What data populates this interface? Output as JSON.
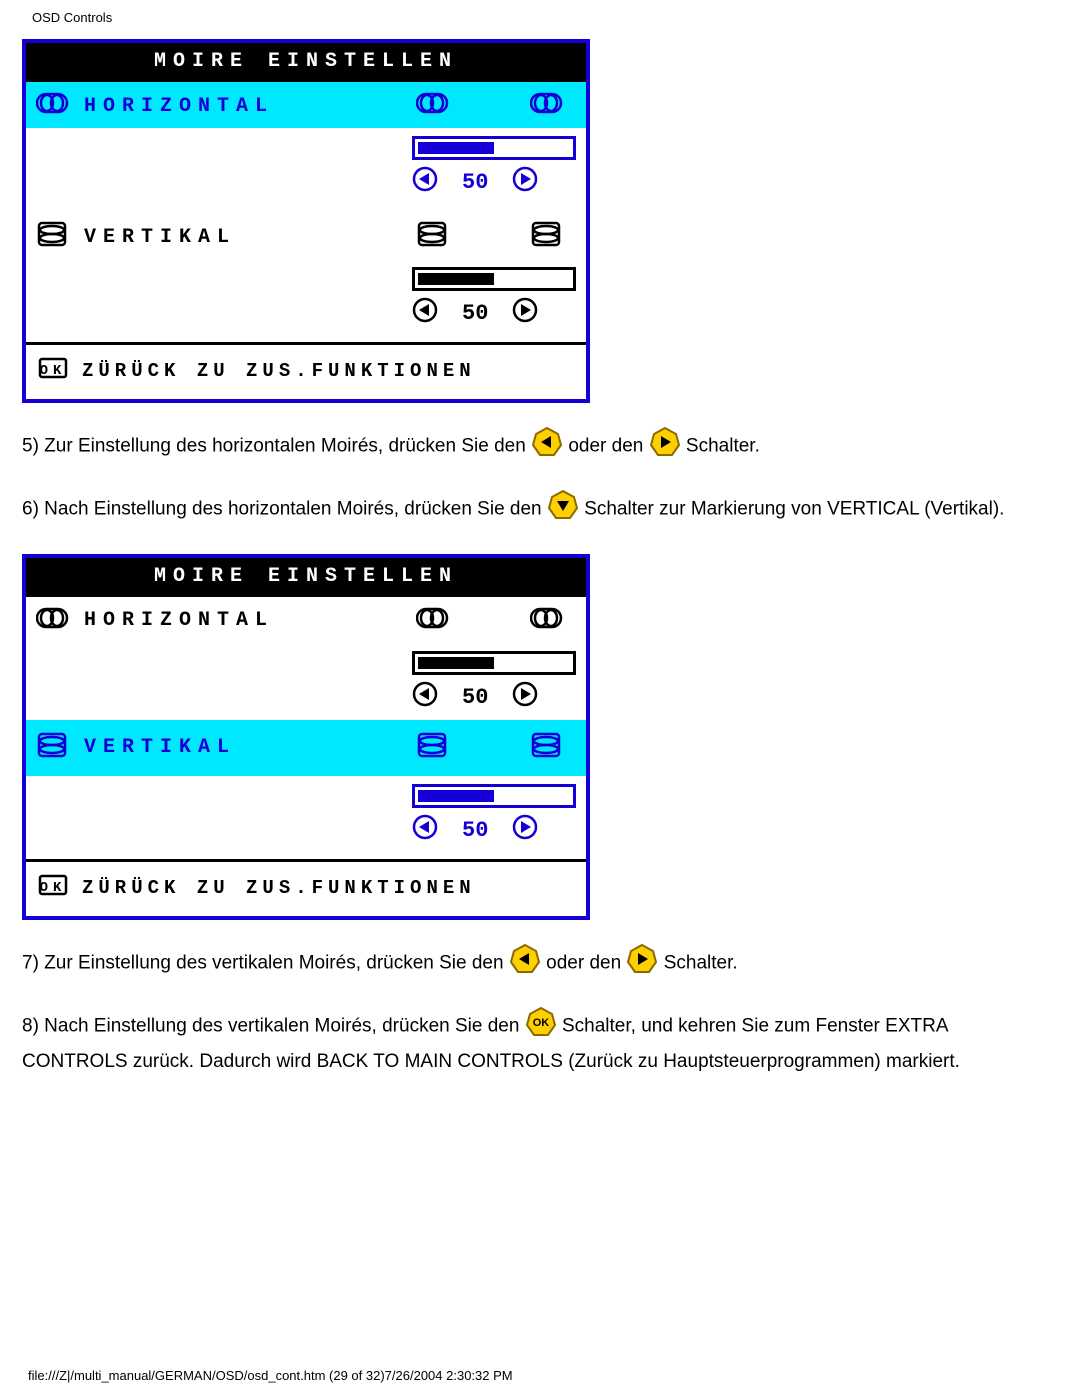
{
  "header": "OSD Controls",
  "panel1": {
    "title": "MOIRE EINSTELLEN",
    "row_h": {
      "label": "HORIZONTAL",
      "value": "50",
      "highlighted": true
    },
    "row_v": {
      "label": "VERTIKAL",
      "value": "50",
      "highlighted": false
    },
    "back": "ZÜRÜCK ZU ZUS.FUNKTIONEN"
  },
  "panel2": {
    "title": "MOIRE EINSTELLEN",
    "row_h": {
      "label": "HORIZONTAL",
      "value": "50",
      "highlighted": false
    },
    "row_v": {
      "label": "VERTIKAL",
      "value": "50",
      "highlighted": true
    },
    "back": "ZÜRÜCK ZU ZUS.FUNKTIONEN"
  },
  "step5": {
    "pre": "5) Zur Einstellung des horizontalen Moirés, drücken Sie den ",
    "mid": " oder den ",
    "post": " Schalter."
  },
  "step6": {
    "pre": "6) Nach Einstellung des horizontalen Moirés, drücken Sie den ",
    "post": " Schalter zur Markierung von VERTICAL (Vertikal)."
  },
  "step7": {
    "pre": "7) Zur Einstellung des vertikalen Moirés, drücken Sie den ",
    "mid": " oder den ",
    "post": " Schalter."
  },
  "step8": {
    "pre": "8) Nach Einstellung des vertikalen Moirés, drücken Sie den ",
    "post": " Schalter, und kehren Sie zum Fenster EXTRA CONTROLS zurück. Dadurch wird BACK TO MAIN CONTROLS (Zurück zu Hauptsteuerprogrammen) markiert."
  },
  "footer": "file:///Z|/multi_manual/GERMAN/OSD/osd_cont.htm (29 of 32)7/26/2004 2:30:32 PM"
}
